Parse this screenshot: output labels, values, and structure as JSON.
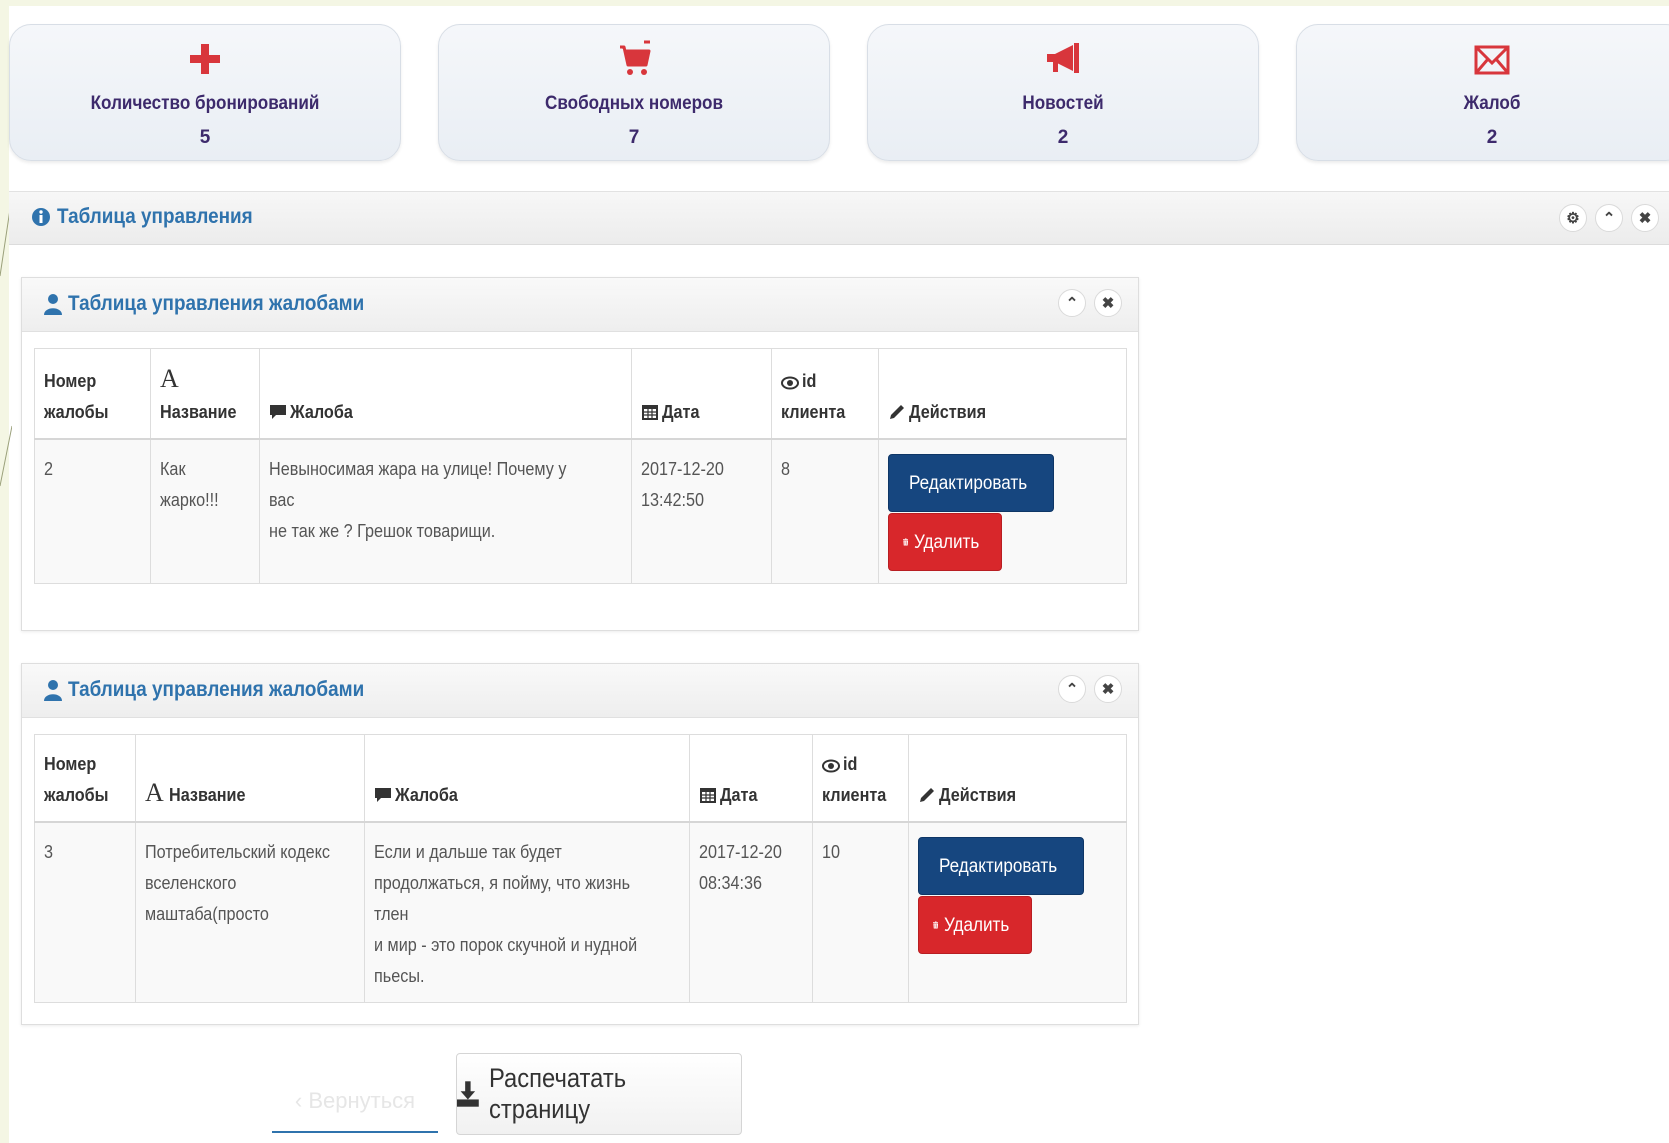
{
  "stats": [
    {
      "icon": "plus-icon",
      "label": "Количество бронирований",
      "value": "5"
    },
    {
      "icon": "cart-icon",
      "label": "Свободных номеров",
      "value": "7"
    },
    {
      "icon": "bullhorn-icon",
      "label": "Новостей",
      "value": "2"
    },
    {
      "icon": "envelope-icon",
      "label": "Жалоб",
      "value": "2"
    }
  ],
  "main_panel": {
    "title": "Таблица управления"
  },
  "complaint_tables": [
    {
      "title": "Таблица управления жалобами",
      "headers": {
        "number_line1": "Номер",
        "number_line2": "жалобы",
        "name": "Название",
        "complaint": "Жалоба",
        "date": "Дата",
        "client_line1": "id",
        "client_line2": "клиента",
        "actions": "Действия"
      },
      "row": {
        "number": "2",
        "name_line1": "Как",
        "name_line2": "жарко!!!",
        "complaint_line1": "Невыносимая жара на улице! Почему у вас",
        "complaint_line2": "не так же ? Грешок товарищи.",
        "date_line1": "2017-12-20",
        "date_line2": "13:42:50",
        "client_id": "8",
        "edit_label": "Редактировать",
        "delete_label": "Удалить"
      }
    },
    {
      "title": "Таблица управления жалобами",
      "headers": {
        "number_line1": "Номер",
        "number_line2": "жалобы",
        "name": "Название",
        "complaint": "Жалоба",
        "date": "Дата",
        "client_line1": "id",
        "client_line2": "клиента",
        "actions": "Действия"
      },
      "row": {
        "number": "3",
        "name_line1": "Потребительский кодекс",
        "name_line2": "вселенского",
        "name_line3": "маштаба(просто",
        "complaint_line1": "Если и дальше так будет",
        "complaint_line2": "продолжаться, я пойму, что жизнь тлен",
        "complaint_line3": "и мир - это порок скучной и нудной",
        "complaint_line4": "пьесы.",
        "date_line1": "2017-12-20",
        "date_line2": "08:34:36",
        "client_id": "10",
        "edit_label": "Редактировать",
        "delete_label": "Удалить"
      }
    }
  ],
  "footer": {
    "back_label": "Вернуться",
    "print_label": "Распечатать страницу"
  },
  "colors": {
    "accent_blue": "#2f73ad",
    "stat_text": "#3d2a6c",
    "icon_red": "#d8363c",
    "edit_button": "#16467f",
    "delete_button": "#d8272b"
  }
}
